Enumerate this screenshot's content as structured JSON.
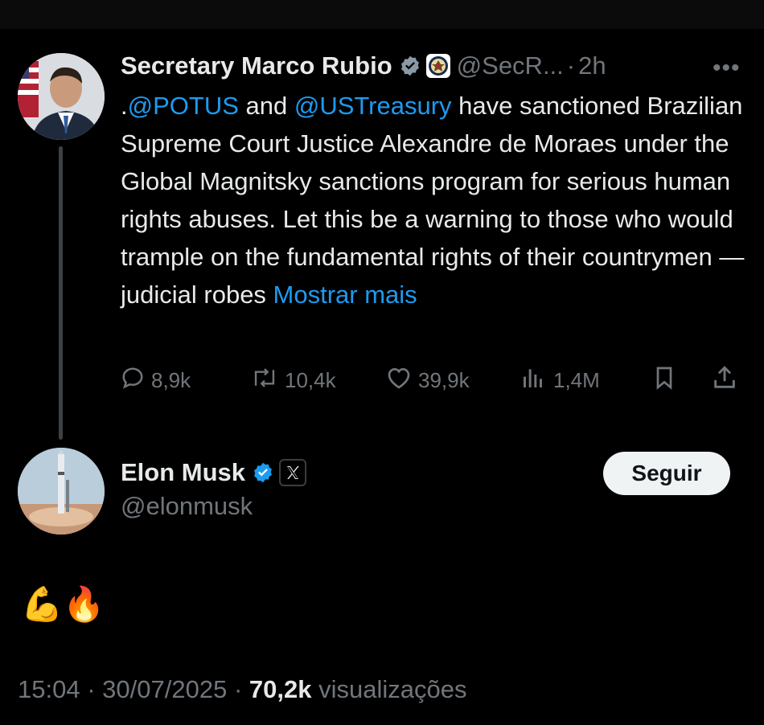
{
  "parent_tweet": {
    "author_name": "Secretary Marco Rubio",
    "handle": "@SecR...",
    "time": "2h",
    "more_glyph": "•••",
    "text_prefix": ".",
    "mention1": "@POTUS",
    "text_and": " and ",
    "mention2": "@USTreasury",
    "text_body": " have sanctioned Brazilian Supreme Court Justice Alexandre de Moraes under the Global Magnitsky sanctions program for serious human rights abuses. Let this be a warning to those who would trample on the fundamental rights of their countrymen —judicial robes ",
    "show_more": "Mostrar mais",
    "stats": {
      "replies": "8,9k",
      "reposts": "10,4k",
      "likes": "39,9k",
      "views": "1,4M"
    },
    "icons": [
      "verified-badge-icon",
      "state-department-seal-icon",
      "more-icon",
      "reply-icon",
      "repost-icon",
      "like-icon",
      "views-icon",
      "bookmark-icon",
      "share-icon"
    ]
  },
  "reply_tweet": {
    "author_name": "Elon Musk",
    "handle": "@elonmusk",
    "follow_label": "Seguir",
    "text": "💪🔥",
    "time": "15:04",
    "date": "30/07/2025",
    "views_count": "70,2k",
    "views_label": "visualizações",
    "separator": "·"
  },
  "colors": {
    "background": "#000000",
    "text": "#e7e9ea",
    "secondary": "#71767b",
    "link": "#1d9bf0",
    "verified": "#1d9bf0",
    "button_bg": "#eff3f4"
  }
}
